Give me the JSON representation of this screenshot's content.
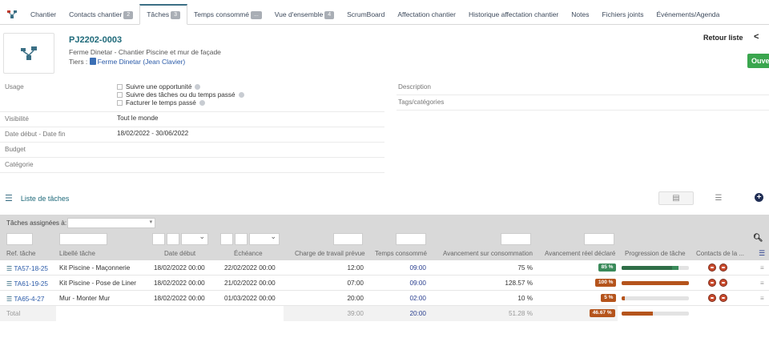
{
  "tabs": [
    {
      "label": "Chantier",
      "badge": ""
    },
    {
      "label": "Contacts chantier",
      "badge": "2"
    },
    {
      "label": "Tâches",
      "badge": "3"
    },
    {
      "label": "Temps consommé",
      "badge": "..."
    },
    {
      "label": "Vue d'ensemble",
      "badge": "4"
    },
    {
      "label": "ScrumBoard",
      "badge": ""
    },
    {
      "label": "Affectation chantier",
      "badge": ""
    },
    {
      "label": "Historique affectation chantier",
      "badge": ""
    },
    {
      "label": "Notes",
      "badge": ""
    },
    {
      "label": "Fichiers joints",
      "badge": ""
    },
    {
      "label": "Événements/Agenda",
      "badge": ""
    }
  ],
  "active_tab": 2,
  "header": {
    "ref": "PJ2202-0003",
    "subtitle": "Ferme Dinetar - Chantier Piscine et mur de façade",
    "tiers_label": "Tiers :",
    "tiers_value": "Ferme Dinetar (Jean Clavier)",
    "back_label": "Retour liste",
    "green_button": "Ouve"
  },
  "fields": {
    "usage_label": "Usage",
    "usage_options": [
      "Suivre une opportunité",
      "Suivre des tâches ou du temps passé",
      "Facturer le temps passé"
    ],
    "visibility_label": "Visibilité",
    "visibility_value": "Tout le monde",
    "dates_label": "Date début - Date fin",
    "dates_value": "18/02/2022 - 30/06/2022",
    "budget_label": "Budget",
    "category_label": "Catégorie",
    "description_label": "Description",
    "tags_label": "Tags/catégories"
  },
  "list": {
    "title": "Liste de tâches",
    "filter_label": "Tâches assignées à:"
  },
  "columns": [
    "Ref. tâche",
    "Libellé tâche",
    "Date début",
    "Échéance",
    "Charge de travail prévue",
    "Temps consommé",
    "Avancement sur consommation",
    "Avancement réel déclaré",
    "Progression de tâche",
    "Contacts de la ..."
  ],
  "rows": [
    {
      "ref": "TA57-18-25",
      "label": "Kit Piscine - Maçonnerie",
      "start": "18/02/2022 00:00",
      "due": "22/02/2022 00:00",
      "planned": "12:00",
      "spent": "09:00",
      "cons_pct": "75 %",
      "declared": "85 %",
      "declared_value": 85,
      "progress_main": 85,
      "progress_cons": 75,
      "color": "#3a8a5a"
    },
    {
      "ref": "TA61-19-25",
      "label": "Kit Piscine - Pose de Liner",
      "start": "18/02/2022 00:00",
      "due": "21/02/2022 00:00",
      "planned": "07:00",
      "spent": "09:00",
      "cons_pct": "128.57 %",
      "declared": "100 %",
      "declared_value": 100,
      "progress_main": 100,
      "progress_cons": 100,
      "color": "#b5541c"
    },
    {
      "ref": "TA65-4-27",
      "label": "Mur - Monter Mur",
      "start": "18/02/2022 00:00",
      "due": "01/03/2022 00:00",
      "planned": "20:00",
      "spent": "02:00",
      "cons_pct": "10 %",
      "declared": "5 %",
      "declared_value": 5,
      "progress_main": 5,
      "progress_cons": 10,
      "color": "#b5541c"
    }
  ],
  "total": {
    "label": "Total",
    "planned": "39:00",
    "spent": "20:00",
    "cons_pct": "51.28 %",
    "declared": "46.67 %",
    "declared_value": 46.67,
    "color": "#b5541c"
  }
}
